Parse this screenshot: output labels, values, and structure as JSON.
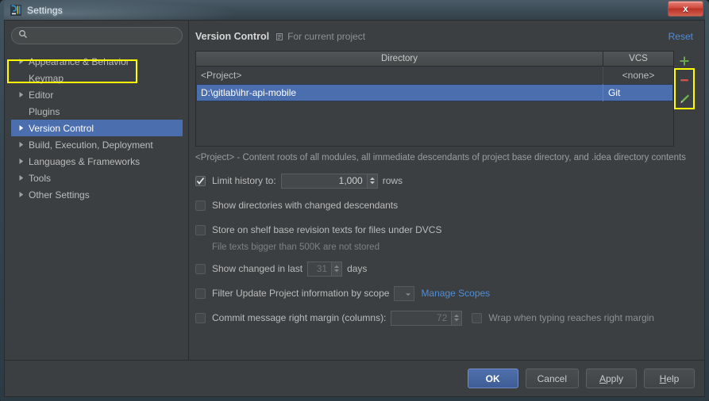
{
  "window": {
    "title": "Settings",
    "app_icon": "intellij-idea-icon",
    "close_label": "x"
  },
  "search": {
    "placeholder": "",
    "value": "",
    "icon": "search-icon"
  },
  "sidebar": {
    "items": [
      {
        "label": "Appearance & Behavior",
        "expandable": true,
        "selected": false
      },
      {
        "label": "Keymap",
        "expandable": false,
        "selected": false
      },
      {
        "label": "Editor",
        "expandable": true,
        "selected": false
      },
      {
        "label": "Plugins",
        "expandable": false,
        "selected": false
      },
      {
        "label": "Version Control",
        "expandable": true,
        "selected": true
      },
      {
        "label": "Build, Execution, Deployment",
        "expandable": true,
        "selected": false
      },
      {
        "label": "Languages & Frameworks",
        "expandable": true,
        "selected": false
      },
      {
        "label": "Tools",
        "expandable": true,
        "selected": false
      },
      {
        "label": "Other Settings",
        "expandable": true,
        "selected": false
      }
    ]
  },
  "header": {
    "title": "Version Control",
    "scope_icon": "project-icon",
    "scope_text": "For current project",
    "reset_label": "Reset"
  },
  "table": {
    "columns": [
      "Directory",
      "VCS"
    ],
    "rows": [
      {
        "directory": "<Project>",
        "vcs": "<none>",
        "selected": false
      },
      {
        "directory": "D:\\gitlab\\ihr-api-mobile",
        "vcs": "Git",
        "selected": true
      }
    ],
    "actions": [
      {
        "name": "add-directory-button",
        "icon": "plus-icon",
        "color": "#6aa84f"
      },
      {
        "name": "remove-directory-button",
        "icon": "minus-icon",
        "color": "#c9534f"
      },
      {
        "name": "edit-directory-button",
        "icon": "pencil-icon",
        "color": "#7bbd5a"
      }
    ]
  },
  "description": "<Project> - Content roots of all modules, all immediate descendants of project base directory, and .idea directory contents",
  "options": {
    "limit_history": {
      "label": "Limit history to:",
      "checked": true,
      "value": "1,000",
      "suffix": "rows"
    },
    "show_directories": {
      "label": "Show directories with changed descendants",
      "checked": false
    },
    "store_on_shelf": {
      "label": "Store on shelf base revision texts for files under DVCS",
      "checked": false,
      "note": "File texts bigger than 500K are not stored"
    },
    "show_changed_in_last": {
      "label": "Show changed in last",
      "checked": false,
      "value": "31",
      "suffix": "days"
    },
    "filter_by_scope": {
      "label": "Filter Update Project information by scope",
      "checked": false,
      "scope_value": "",
      "manage_link": "Manage Scopes"
    },
    "commit_right_margin": {
      "label": "Commit message right margin (columns):",
      "checked": false,
      "value": "72",
      "wrap_label": "Wrap when typing reaches right margin",
      "wrap_checked": false
    }
  },
  "footer": {
    "ok": "OK",
    "cancel": "Cancel",
    "apply_pre": "A",
    "apply_post": "pply",
    "help_pre": "H",
    "help_post": "elp"
  }
}
